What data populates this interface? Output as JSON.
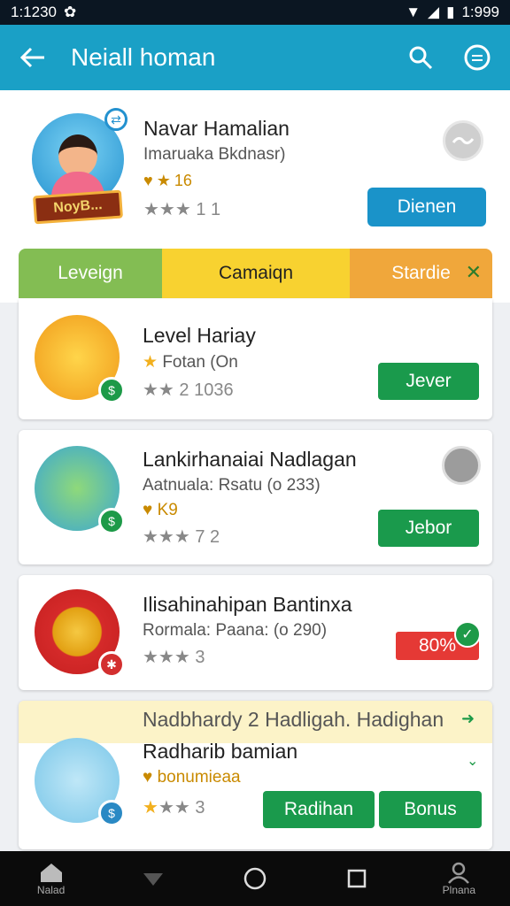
{
  "status_bar": {
    "time": "1:1230",
    "battery": "1:999"
  },
  "app_bar": {
    "title": "Neiall homan"
  },
  "profile": {
    "name": "Navar Hamalian",
    "subtitle": "Imaruaka Bkdnasr)",
    "coins": "16",
    "rating": "1 1",
    "tag": "NoyB...",
    "button": "Dienen"
  },
  "tabs": [
    "Leveign",
    "Camaiqn",
    "Stardie"
  ],
  "cards": [
    {
      "title": "Level Hariay",
      "subtitle": "Fotan (On",
      "rating": "2 1036",
      "button": "Jever"
    },
    {
      "title": "Lankirhanaiai Nadlagan",
      "subtitle": "Aatnuala: Rsatu (o 233)",
      "coins": "K9",
      "rating": "7 2",
      "button": "Jebor"
    },
    {
      "title": "Ilisahinahipan Bantinxa",
      "subtitle": "Rormala: Paana: (o 290)",
      "rating": "3",
      "badge": "80%"
    },
    {
      "banner": "Nadbhardy 2 Hadligah. Hadighan",
      "title": "Radharib bamian",
      "coins": "bonumieaa",
      "rating": "3",
      "button1": "Radihan",
      "button2": "Bonus"
    }
  ],
  "nav": {
    "home": "Nalad",
    "profile": "Plnana"
  },
  "colors": {
    "app_bar": "#1aa0c6",
    "green": "#1a9a4c",
    "blue": "#1a93c9",
    "red": "#e53935"
  },
  "icons": [
    "back-arrow-icon",
    "search-icon",
    "menu-circle-icon",
    "home-icon",
    "person-icon"
  ]
}
